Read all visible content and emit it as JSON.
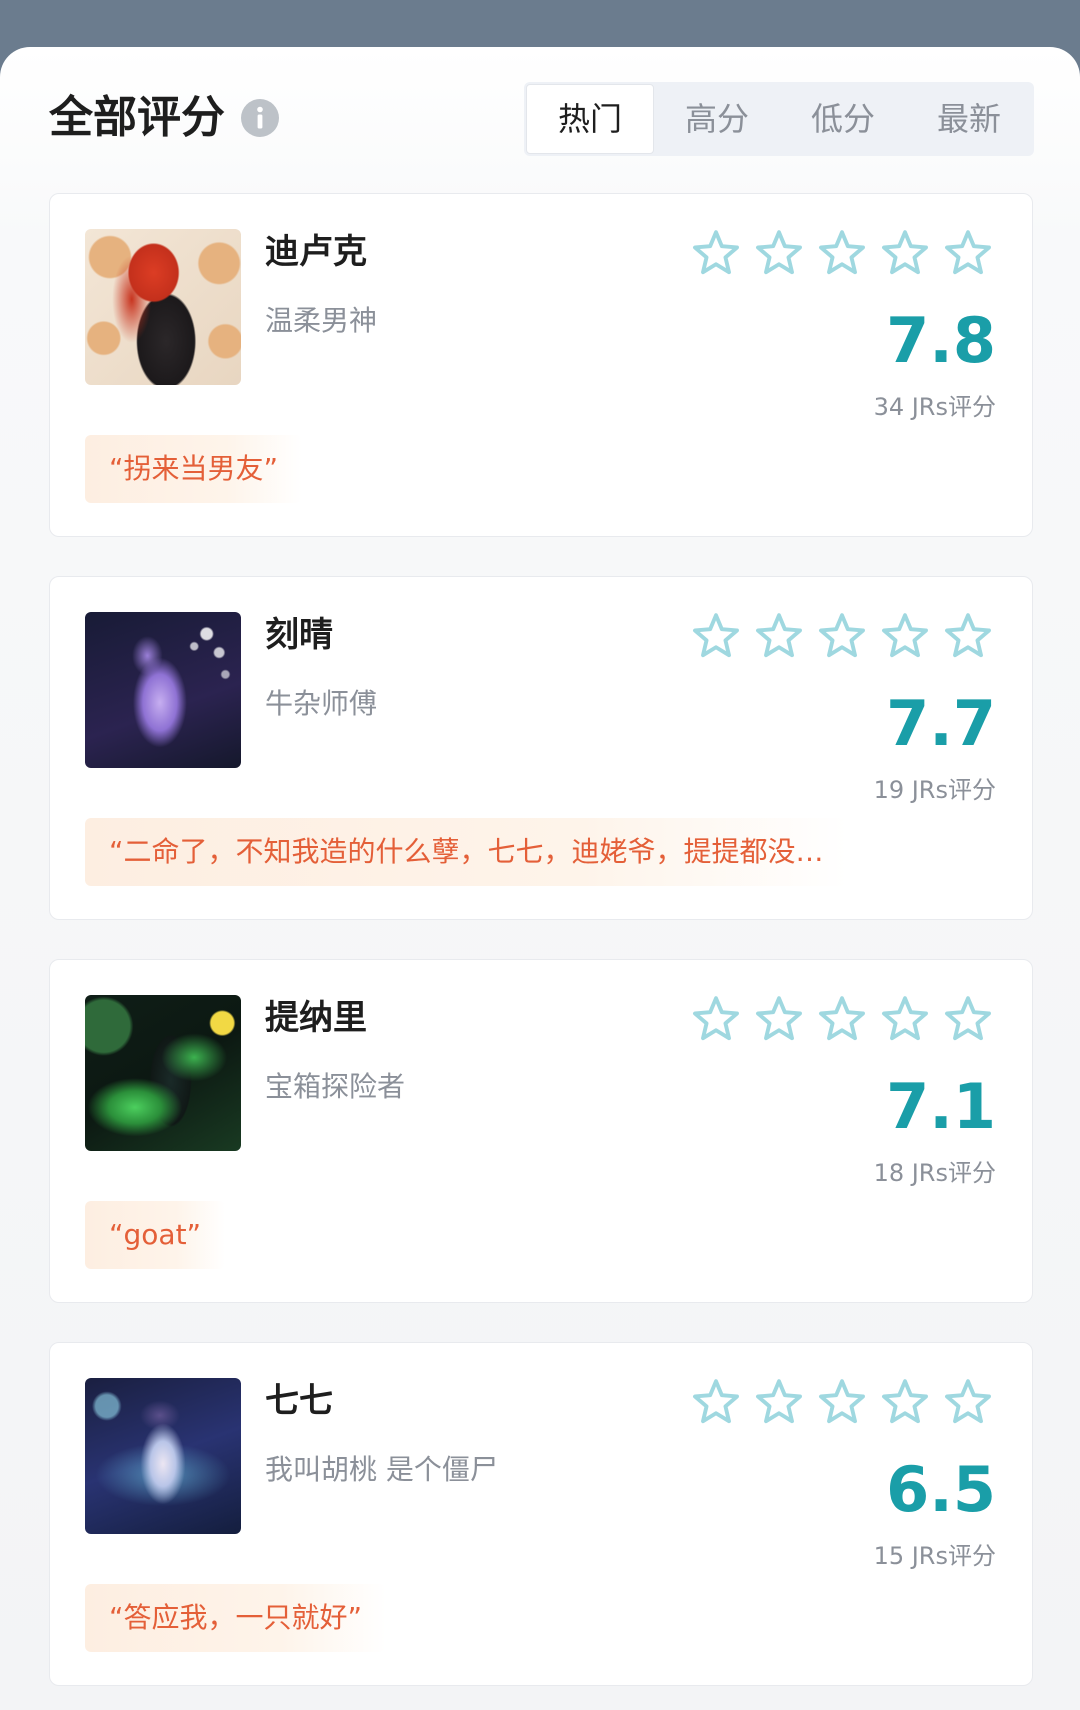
{
  "header": {
    "title": "全部评分",
    "info_icon": "info-icon"
  },
  "tabs": [
    {
      "label": "热门",
      "selected": true
    },
    {
      "label": "高分",
      "selected": false
    },
    {
      "label": "低分",
      "selected": false
    },
    {
      "label": "最新",
      "selected": false
    }
  ],
  "star_rating": {
    "max": 5,
    "filled": 0,
    "icon": "star-outline-icon"
  },
  "cards": [
    {
      "name": "迪卢克",
      "subtitle": "温柔男神",
      "score": "7.8",
      "rating_count": "34 JRs评分",
      "quote": "“拐来当男友”"
    },
    {
      "name": "刻晴",
      "subtitle": "牛杂师傅",
      "score": "7.7",
      "rating_count": "19 JRs评分",
      "quote": "“二命了，不知我造的什么孽，七七，迪姥爷，提提都没…"
    },
    {
      "name": "提纳里",
      "subtitle": "宝箱探险者",
      "score": "7.1",
      "rating_count": "18 JRs评分",
      "quote": "“goat”"
    },
    {
      "name": "七七",
      "subtitle": "我叫胡桃 是个僵尸",
      "score": "6.5",
      "rating_count": "15 JRs评分",
      "quote": "“答应我，一只就好”"
    }
  ],
  "colors": {
    "accent": "#1a9ea8",
    "star": "#9fd8e0",
    "quote_text": "#e45f38",
    "top_bar": "#6b7c8e"
  }
}
